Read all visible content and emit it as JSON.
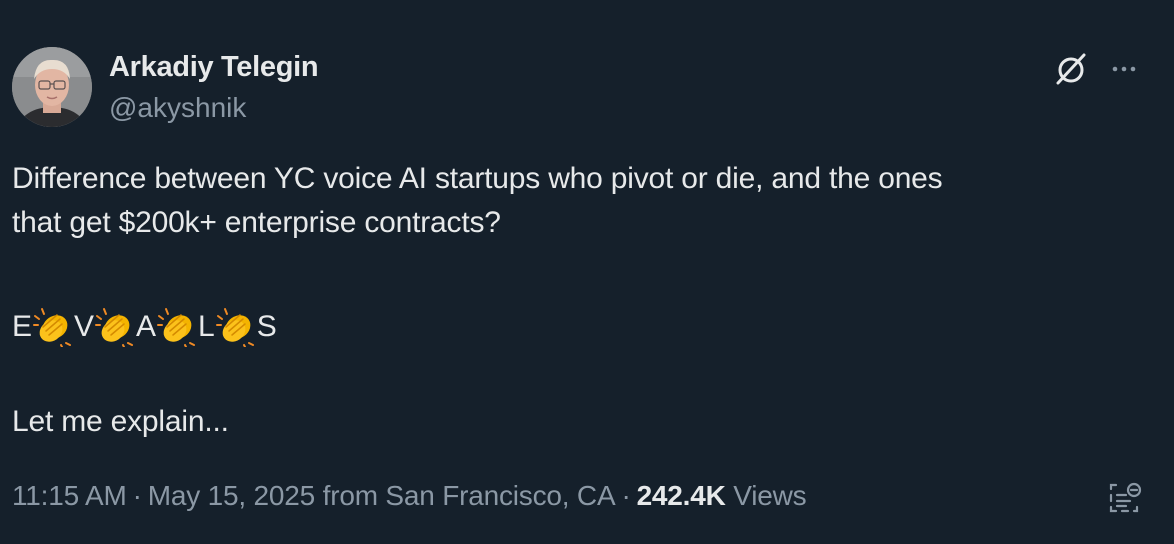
{
  "author": {
    "name": "Arkadiy Telegin",
    "handle": "@akyshnik",
    "avatar_icon": "profile-photo"
  },
  "header_actions": {
    "grok_icon": "grok-icon",
    "more_icon": "more-icon"
  },
  "tweet": {
    "line1": "Difference between YC voice AI startups who pivot or die, and the ones",
    "line2": "that get $200k+ enterprise contracts?",
    "evals_letters": [
      "E",
      "V",
      "A",
      "L",
      "S"
    ],
    "separator_emoji": "clapping-hands",
    "line4": "Let me explain..."
  },
  "meta": {
    "time": "11:15 AM",
    "date": "May 15, 2025",
    "location": "from San Francisco, CA",
    "separator": "·",
    "views_count": "242.4K",
    "views_label": "Views"
  },
  "colors": {
    "background": "#15202b",
    "primary_text": "#e7e9ea",
    "secondary_text": "#8b98a5"
  }
}
